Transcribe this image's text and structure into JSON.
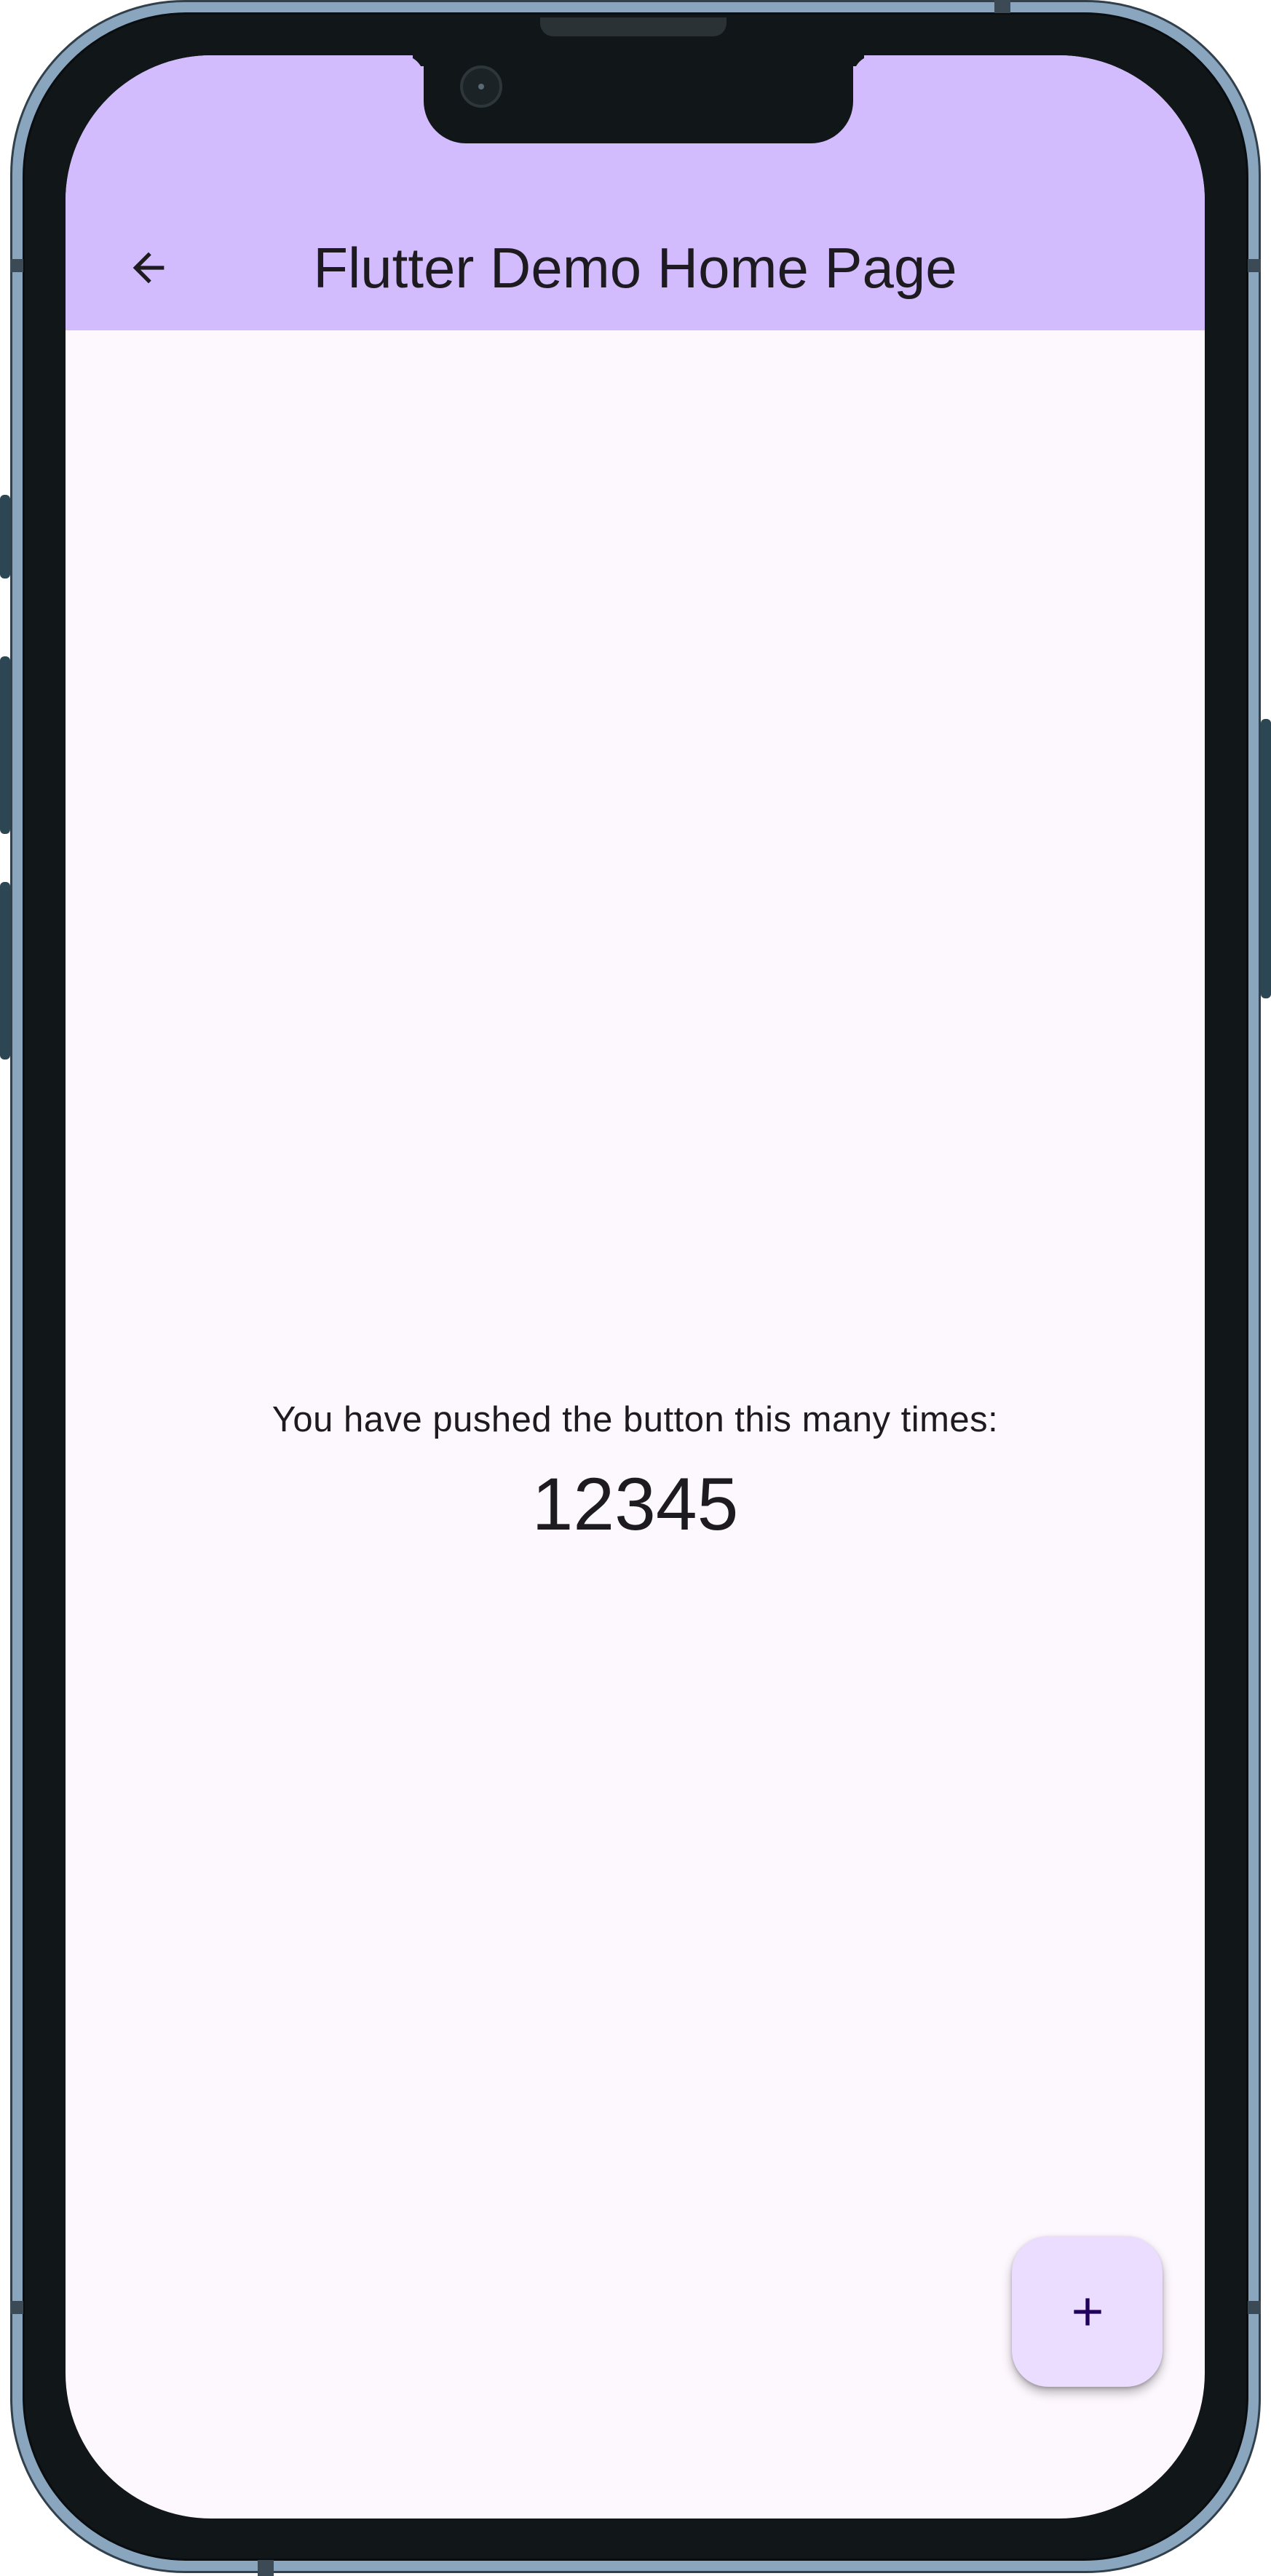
{
  "app_bar": {
    "title": "Flutter Demo Home Page",
    "back_icon": "arrow-back-icon",
    "background": "#d3bcfd"
  },
  "body": {
    "caption": "You have pushed the button this many times:",
    "counter": "12345",
    "background": "#fdf7fe"
  },
  "fab": {
    "icon": "add-icon",
    "background": "#eaddff",
    "icon_color": "#21005d"
  },
  "device": {
    "frame_color": "#8aa6bf",
    "bezel_color": "#111618"
  }
}
